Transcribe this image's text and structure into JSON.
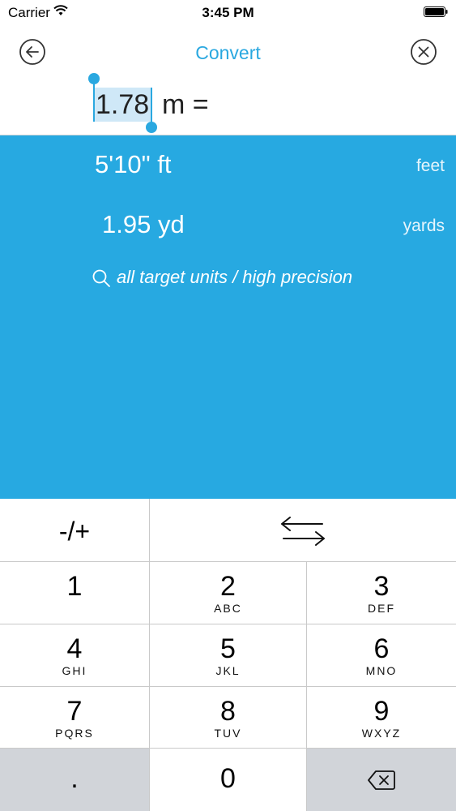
{
  "status_bar": {
    "carrier": "Carrier",
    "time": "3:45 PM"
  },
  "nav": {
    "title": "Convert",
    "back_icon": "back-arrow-circle-icon",
    "close_icon": "close-circle-icon"
  },
  "input": {
    "value": "1.78",
    "unit_expression": "m ="
  },
  "results": [
    {
      "value": "5'10\"  ft",
      "unit_name": "feet"
    },
    {
      "value": "1.95  yd",
      "unit_name": "yards"
    }
  ],
  "more_link": {
    "icon": "search-icon",
    "text": "all target units / high precision"
  },
  "colors": {
    "accent": "#2aa8e0",
    "results_bg": "#27a9e1",
    "key_gray": "#d1d4d9"
  },
  "keypad": {
    "sign_toggle": "-/+",
    "swap_icon": "swap-arrows-icon",
    "keys": [
      {
        "num": "1",
        "letters": ""
      },
      {
        "num": "2",
        "letters": "ABC"
      },
      {
        "num": "3",
        "letters": "DEF"
      },
      {
        "num": "4",
        "letters": "GHI"
      },
      {
        "num": "5",
        "letters": "JKL"
      },
      {
        "num": "6",
        "letters": "MNO"
      },
      {
        "num": "7",
        "letters": "PQRS"
      },
      {
        "num": "8",
        "letters": "TUV"
      },
      {
        "num": "9",
        "letters": "WXYZ"
      }
    ],
    "decimal": ".",
    "zero": "0",
    "backspace_icon": "backspace-icon"
  }
}
